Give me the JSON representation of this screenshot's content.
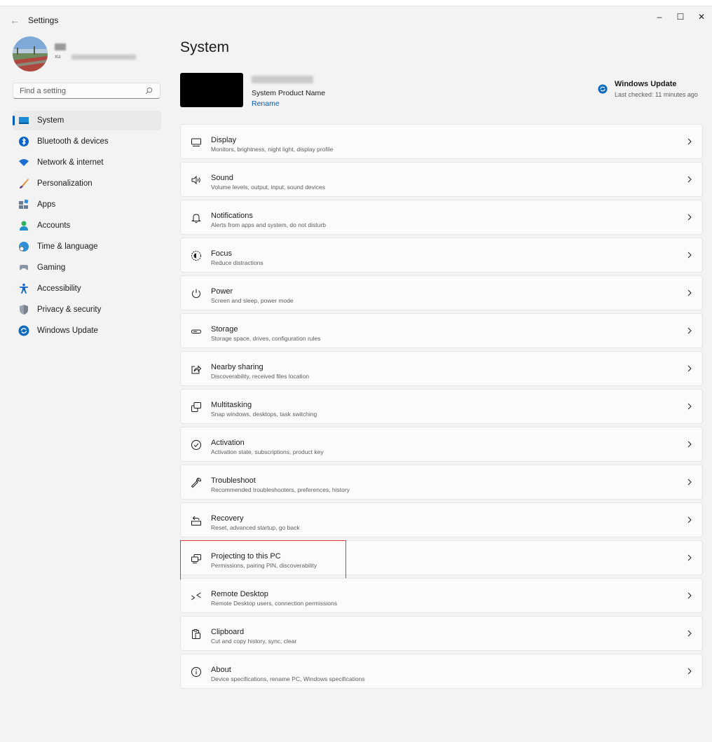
{
  "window": {
    "title": "Settings",
    "back_glyph": "←",
    "minimize_glyph": "–",
    "maximize_glyph": "☐",
    "close_glyph": "✕"
  },
  "profile": {
    "email_prefix": "xu"
  },
  "search": {
    "placeholder": "Find a setting"
  },
  "nav": {
    "items": [
      {
        "label": "System",
        "icon": "system-icon",
        "active": true
      },
      {
        "label": "Bluetooth & devices",
        "icon": "bluetooth-icon"
      },
      {
        "label": "Network & internet",
        "icon": "wifi-icon"
      },
      {
        "label": "Personalization",
        "icon": "brush-icon"
      },
      {
        "label": "Apps",
        "icon": "apps-icon"
      },
      {
        "label": "Accounts",
        "icon": "person-icon"
      },
      {
        "label": "Time & language",
        "icon": "globe-clock-icon"
      },
      {
        "label": "Gaming",
        "icon": "gamepad-icon"
      },
      {
        "label": "Accessibility",
        "icon": "accessibility-icon"
      },
      {
        "label": "Privacy & security",
        "icon": "shield-icon"
      },
      {
        "label": "Windows Update",
        "icon": "update-icon"
      }
    ]
  },
  "page": {
    "title": "System"
  },
  "device": {
    "model": "System Product Name",
    "rename_label": "Rename"
  },
  "windows_update": {
    "title": "Windows Update",
    "status": "Last checked: 11 minutes ago"
  },
  "cards": [
    {
      "title": "Display",
      "desc": "Monitors, brightness, night light, display profile",
      "icon": "monitor-icon"
    },
    {
      "title": "Sound",
      "desc": "Volume levels, output, input, sound devices",
      "icon": "speaker-icon"
    },
    {
      "title": "Notifications",
      "desc": "Alerts from apps and system, do not disturb",
      "icon": "bell-icon"
    },
    {
      "title": "Focus",
      "desc": "Reduce distractions",
      "icon": "focus-icon"
    },
    {
      "title": "Power",
      "desc": "Screen and sleep, power mode",
      "icon": "power-icon"
    },
    {
      "title": "Storage",
      "desc": "Storage space, drives, configuration rules",
      "icon": "storage-icon"
    },
    {
      "title": "Nearby sharing",
      "desc": "Discoverability, received files location",
      "icon": "share-icon"
    },
    {
      "title": "Multitasking",
      "desc": "Snap windows, desktops, task switching",
      "icon": "multitasking-icon"
    },
    {
      "title": "Activation",
      "desc": "Activation state, subscriptions, product key",
      "icon": "check-circle-icon"
    },
    {
      "title": "Troubleshoot",
      "desc": "Recommended troubleshooters, preferences, history",
      "icon": "wrench-icon"
    },
    {
      "title": "Recovery",
      "desc": "Reset, advanced startup, go back",
      "icon": "recovery-icon"
    },
    {
      "title": "Projecting to this PC",
      "desc": "Permissions, pairing PIN, discoverability",
      "icon": "projecting-icon",
      "highlighted": true
    },
    {
      "title": "Remote Desktop",
      "desc": "Remote Desktop users, connection permissions",
      "icon": "remote-desktop-icon"
    },
    {
      "title": "Clipboard",
      "desc": "Cut and copy history, sync, clear",
      "icon": "clipboard-icon"
    },
    {
      "title": "About",
      "desc": "Device specifications, rename PC, Windows specifications",
      "icon": "info-icon"
    }
  ],
  "colors": {
    "accent": "#005fb8",
    "highlight_box": "#e23b3b",
    "background": "#f3f3f3",
    "card": "#fbfbfb"
  }
}
